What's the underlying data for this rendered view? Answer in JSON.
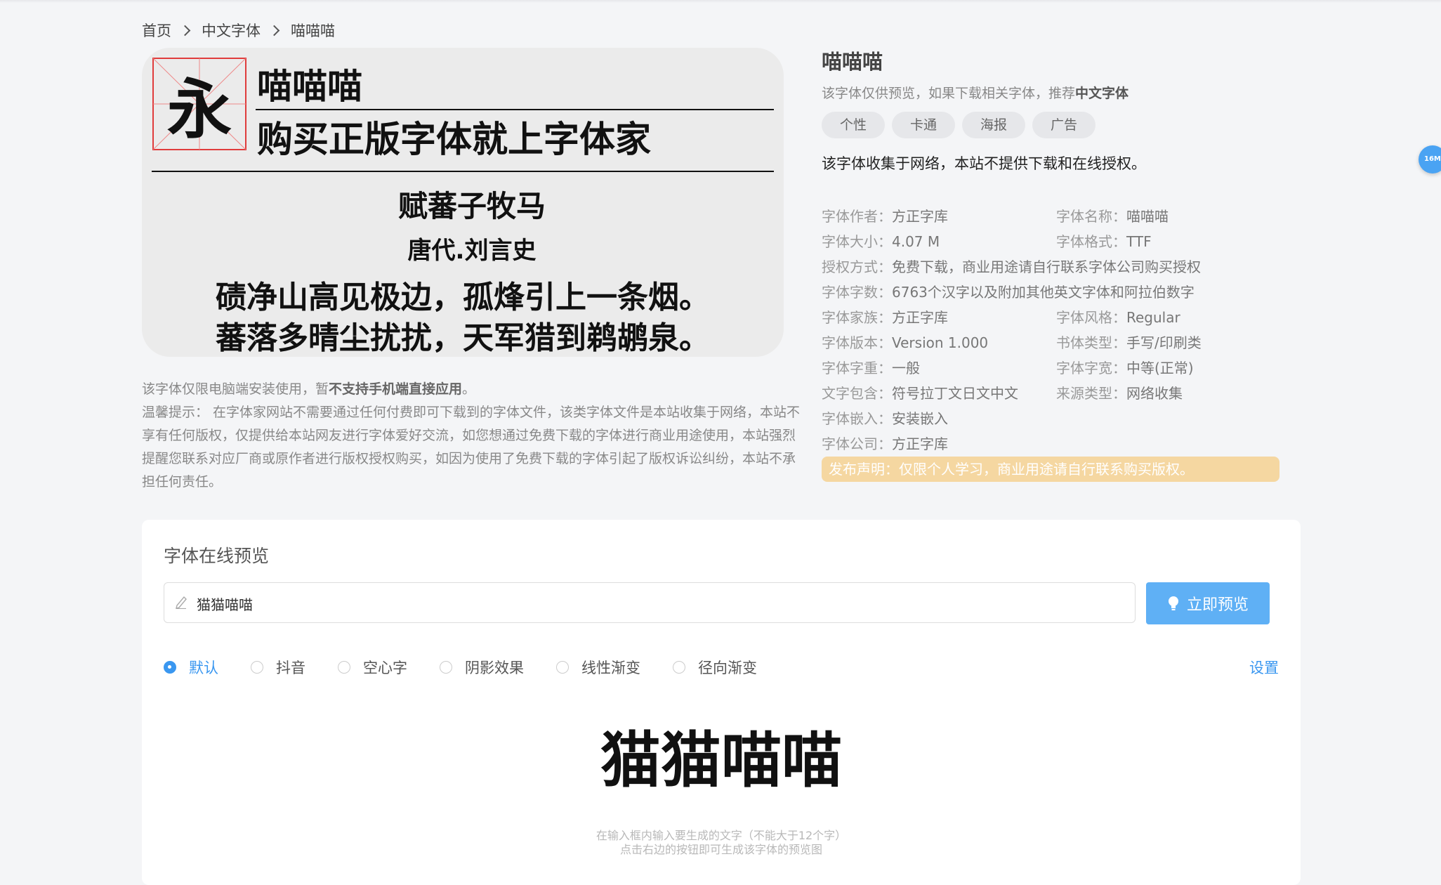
{
  "breadcrumb": [
    "首页",
    "中文字体",
    "喵喵喵"
  ],
  "preview_image": {
    "sample_char": "永",
    "line1": "喵喵喵",
    "line2": "购买正版字体就上字体家",
    "poem_title": "赋蕃子牧马",
    "poem_author": "唐代.刘言史",
    "poem_line1": "碛净山高见极边，孤烽引上一条烟。",
    "poem_line2": "蕃落多晴尘扰扰，天军猎到鹈鹕泉。"
  },
  "notice": {
    "line1_pre": "该字体仅限电脑端安装使用，暂",
    "line1_bold": "不支持手机端直接应用",
    "line1_post": "。",
    "tip": "温馨提示：  在字体家网站不需要通过任何付费即可下载到的字体文件，该类字体文件是本站收集于网络，本站不享有任何版权，仅提供给本站网友进行字体爱好交流，如您想通过免费下载的字体进行商业用途使用，本站强烈提醒您联系对应厂商或原作者进行版权授权购买，如因为使用了免费下载的字体引起了版权诉讼纠纷，本站不承担任何责任。"
  },
  "info": {
    "title": "喵喵喵",
    "recommend_pre": "该字体仅供预览，如果下载相关字体，推荐",
    "recommend_link": "中文字体",
    "tags": [
      "个性",
      "卡通",
      "海报",
      "广告"
    ],
    "collect_note": "该字体收集于网络，本站不提供下载和在线授权。"
  },
  "meta": {
    "author_k": "字体作者：",
    "author_v": "方正字库",
    "name_k": "字体名称：",
    "name_v": "喵喵喵",
    "size_k": "字体大小：",
    "size_v": "4.07 M",
    "format_k": "字体格式：",
    "format_v": "TTF",
    "license_k": "授权方式：",
    "license_v": "免费下载，商业用途请自行联系字体公司购买授权",
    "count_k": "字体字数：",
    "count_v": "6763个汉字以及附加其他英文字体和阿拉伯数字",
    "family_k": "字体家族：",
    "family_v": "方正字库",
    "style_k": "字体风格：",
    "style_v": "Regular",
    "version_k": "字体版本：",
    "version_v": "Version 1.000",
    "type_k": "书体类型：",
    "type_v": "手写/印刷类",
    "weight_k": "字体字重：",
    "weight_v": "一般",
    "width_k": "字体字宽：",
    "width_v": "中等(正常)",
    "contains_k": "文字包含：",
    "contains_v": "符号拉丁文日文中文",
    "source_k": "来源类型：",
    "source_v": "网络收集",
    "embed_k": "字体嵌入：",
    "embed_v": "安装嵌入",
    "company_k": "字体公司：",
    "company_v": "方正字库",
    "release": "发布声明：仅限个人学习，商业用途请自行联系购买版权。"
  },
  "side_badge": "16M",
  "online": {
    "title": "字体在线预览",
    "input_value": "猫猫喵喵",
    "button": "立即预览",
    "options": [
      "默认",
      "抖音",
      "空心字",
      "阴影效果",
      "线性渐变",
      "径向渐变"
    ],
    "selected": "默认",
    "settings": "设置",
    "rendered_text": "猫猫喵喵",
    "hint1": "在输入框内输入要生成的文字（不能大于12个字）",
    "hint2": "点击右边的按钮即可生成该字体的预览图"
  },
  "colors": {
    "accent": "#3a97f0",
    "button": "#5fb0f5",
    "release_bg": "#f5d7a1",
    "grid_red": "#e03c3c"
  }
}
